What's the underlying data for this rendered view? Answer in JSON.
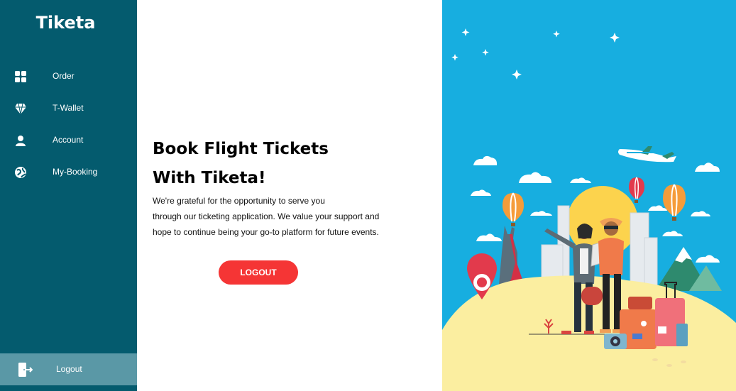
{
  "sidebar": {
    "brand": "Tiketa",
    "items": [
      {
        "label": "Order",
        "icon": "grid-icon"
      },
      {
        "label": "T-Wallet",
        "icon": "diamond-icon"
      },
      {
        "label": "Account",
        "icon": "user-icon"
      },
      {
        "label": "My-Booking",
        "icon": "globe-icon"
      }
    ],
    "logout": {
      "label": "Logout",
      "icon": "logout-icon"
    }
  },
  "main": {
    "heading_line1": "Book Flight Tickets",
    "heading_line2": "With Tiketa!",
    "desc_line1": "We're grateful for the opportunity to serve you",
    "desc_line2": "through our ticketing application. We value your support and",
    "desc_line3": "hope to continue being your go-to platform for future events.",
    "button": "LOGOUT"
  },
  "colors": {
    "sidebar": "#045b6e",
    "sidebar_active": "#5a98a6",
    "button": "#f53535",
    "sky": "#17aee0",
    "sand": "#fbeea0"
  }
}
